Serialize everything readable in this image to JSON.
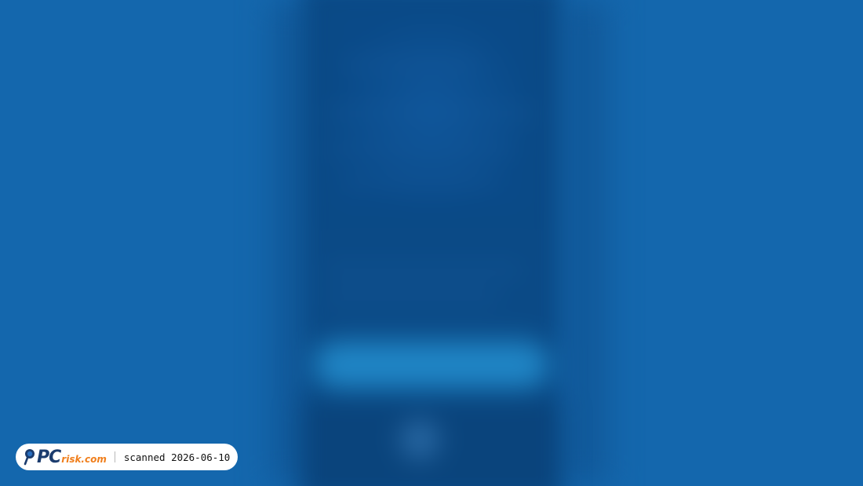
{
  "background_color": "#1467ad",
  "watermark": {
    "logo_primary": "PC",
    "logo_secondary": "risk.com",
    "logo_icon": "magnifier-icon",
    "scan_label": "scanned 2026-06-10",
    "brand_colors": {
      "navy": "#1b3c6e",
      "orange": "#f07e1b"
    }
  }
}
